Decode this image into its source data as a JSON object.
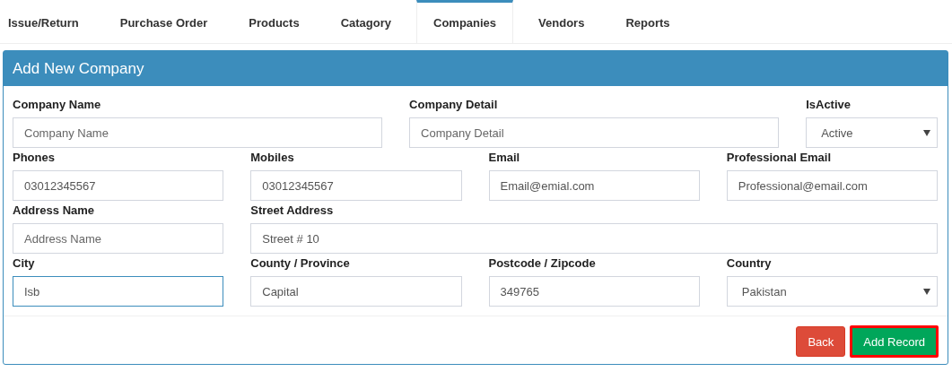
{
  "tabs": [
    {
      "label": "Issue/Return",
      "selected": false
    },
    {
      "label": "Purchase Order",
      "selected": false
    },
    {
      "label": "Products",
      "selected": false
    },
    {
      "label": "Catagory",
      "selected": false
    },
    {
      "label": "Companies",
      "selected": true
    },
    {
      "label": "Vendors",
      "selected": false
    },
    {
      "label": "Reports",
      "selected": false
    }
  ],
  "panel": {
    "title": "Add New Company",
    "rows": [
      [
        {
          "label": "Company Name",
          "kind": "input",
          "placeholder": "Company Name"
        },
        {
          "label": "Company Detail",
          "kind": "input",
          "placeholder": "Company Detail"
        },
        {
          "label": "IsActive",
          "kind": "select",
          "value": "Active"
        }
      ],
      [
        {
          "label": "Phones",
          "kind": "input",
          "value": "03012345567"
        },
        {
          "label": "Mobiles",
          "kind": "input",
          "value": "03012345567"
        },
        {
          "label": "Email",
          "kind": "input",
          "value": "Email@emial.com"
        },
        {
          "label": "Professional Email",
          "kind": "input",
          "value": "Professional@email.com"
        }
      ],
      [
        {
          "label": "Address Name",
          "kind": "input",
          "placeholder": "Address Name"
        },
        {
          "label": "Street Address",
          "kind": "input",
          "value": "Street # 10"
        }
      ],
      [
        {
          "label": "City",
          "kind": "input",
          "value": "Isb",
          "focused": true
        },
        {
          "label": "County / Province",
          "kind": "input",
          "value": "Capital"
        },
        {
          "label": "Postcode / Zipcode",
          "kind": "input",
          "value": "349765"
        },
        {
          "label": "Country",
          "kind": "select",
          "value": "Pakistan"
        }
      ]
    ],
    "buttons": [
      {
        "label": "Back",
        "kind": "danger",
        "outlined": false
      },
      {
        "label": "Add Record",
        "kind": "success",
        "outlined": true
      }
    ]
  }
}
